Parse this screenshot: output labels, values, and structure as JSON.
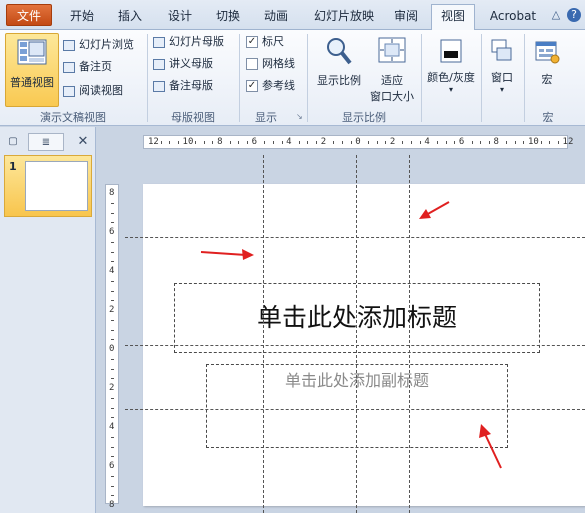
{
  "tabs": {
    "file": "文件",
    "items": [
      "开始",
      "插入",
      "设计",
      "切换",
      "动画",
      "幻灯片放映",
      "审阅",
      "视图",
      "Acrobat"
    ],
    "active": "视图"
  },
  "ribbon": {
    "groups": {
      "presentation_views": "演示文稿视图",
      "master_views": "母版视图",
      "show": "显示",
      "zoom": "显示比例",
      "macros": "宏"
    },
    "normal_view": "普通视图",
    "slide_sorter": "幻灯片浏览",
    "notes_page": "备注页",
    "reading_view": "阅读视图",
    "slide_master": "幻灯片母版",
    "handout_master": "讲义母版",
    "notes_master": "备注母版",
    "ruler": "标尺",
    "gridlines": "网格线",
    "guides": "参考线",
    "zoom": "显示比例",
    "fit_line1": "适应",
    "fit_line2": "窗口大小",
    "color_grayscale": "颜色/灰度",
    "window": "窗口",
    "macros": "宏"
  },
  "checkboxes": {
    "ruler": true,
    "gridlines": false,
    "guides": true
  },
  "slide_pane": {
    "close": "✕",
    "slide_number": "1"
  },
  "ruler": {
    "h_labels": [
      "12",
      "10",
      "8",
      "6",
      "4",
      "2",
      "0",
      "2",
      "4",
      "6",
      "8",
      "10",
      "12"
    ],
    "v_labels": [
      "8",
      "6",
      "4",
      "2",
      "0",
      "2",
      "4",
      "6",
      "8"
    ]
  },
  "slide": {
    "title_placeholder": "单击此处添加标题",
    "subtitle_placeholder": "单击此处添加副标题"
  },
  "colors": {
    "file_tab": "#d35a20",
    "arrow": "#e02020",
    "selected_button": "#f9c952"
  }
}
